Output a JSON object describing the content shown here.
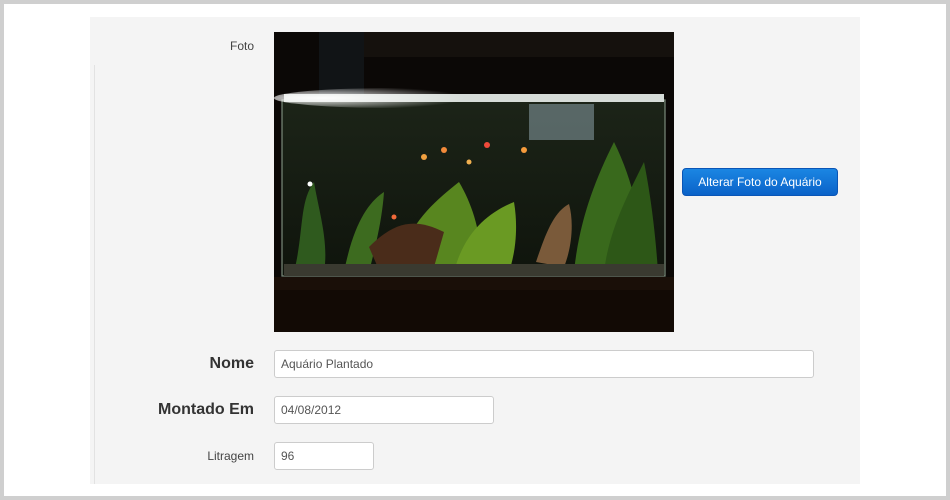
{
  "form": {
    "photo_label": "Foto",
    "change_photo_button": "Alterar Foto do Aquário",
    "nome_label": "Nome",
    "nome_value": "Aquário Plantado",
    "montado_label": "Montado Em",
    "montado_value": "04/08/2012",
    "litragem_label": "Litragem",
    "litragem_value": "96"
  },
  "colors": {
    "button": "#0a62c8",
    "panel_background": "#f4f4f4"
  }
}
